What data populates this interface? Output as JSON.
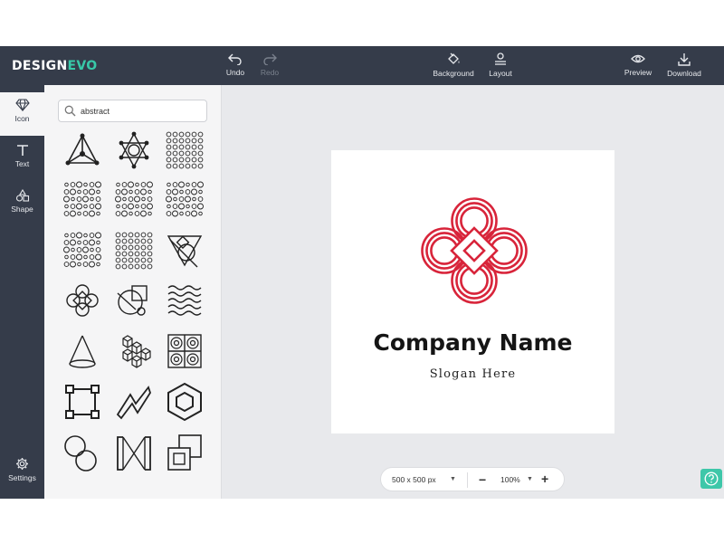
{
  "app": {
    "logo_part1": "DESIGN",
    "logo_part2": "EVO",
    "colors": {
      "topbar": "#353c4a",
      "accent": "#38c9a8",
      "logo_red": "#d8243a",
      "canvas_bg": "#e8e9ec"
    }
  },
  "toolbar": {
    "undo_label": "Undo",
    "redo_label": "Redo",
    "background_label": "Background",
    "layout_label": "Layout",
    "preview_label": "Preview",
    "download_label": "Download"
  },
  "sidebar": {
    "items": [
      {
        "label": "Icon",
        "icon": "diamond-icon",
        "active": true
      },
      {
        "label": "Text",
        "icon": "text-t-icon",
        "active": false
      },
      {
        "label": "Shape",
        "icon": "shapes-icon",
        "active": false
      },
      {
        "label": "Settings",
        "icon": "gear-icon",
        "active": false
      }
    ]
  },
  "search": {
    "value": "abstract",
    "icon": "search-icon"
  },
  "icon_grid": {
    "items": [
      "triangle-molecule-icon",
      "star-network-icon",
      "dot-grid-icon",
      "circle-grid-icon",
      "circle-grid-icon",
      "circle-grid-icon",
      "circle-grid-icon",
      "dot-grid-icon",
      "geometric-triangle-icon",
      "celtic-knot-icon",
      "geometric-circle-icon",
      "waves-icon",
      "cone-icon",
      "cubes-icon",
      "concentric-squares-icon",
      "square-frame-icon",
      "zigzag-icon",
      "hexagon-icon",
      "overlapping-circles-icon",
      "bracket-hexagon-icon",
      "overlapping-squares-icon"
    ]
  },
  "canvas": {
    "company_name": "Company Name",
    "slogan": "Slogan Here",
    "logo_icon": "celtic-knot-logo-icon"
  },
  "zoombar": {
    "size": "500 x 500 px",
    "zoom": "100%",
    "minus": "−",
    "plus": "+"
  },
  "help": {
    "icon": "help-icon"
  }
}
